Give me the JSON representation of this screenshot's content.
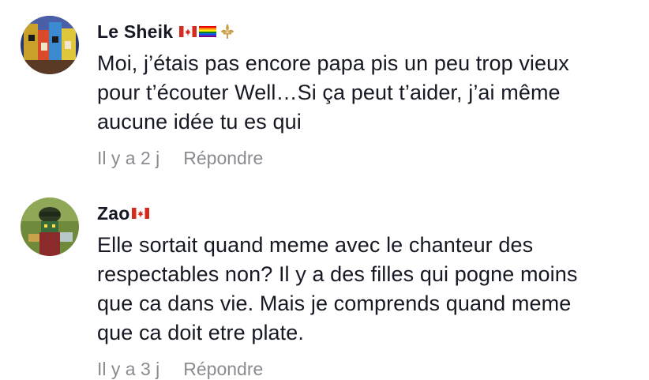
{
  "comments": [
    {
      "username": "Le Sheik",
      "badges": [
        "canada-flag-icon",
        "rainbow-flag-icon",
        "fleur-de-lis-icon"
      ],
      "text": "Moi, j’étais pas encore papa pis un peu trop vieux\npour t’écouter Well…Si ça peut t’aider, j’ai même\naucune idée tu es qui",
      "time": "Il y a 2 j",
      "reply_label": "Répondre"
    },
    {
      "username": "Zao",
      "badges": [
        "canada-flag-icon"
      ],
      "text": "Elle sortait quand meme avec le chanteur des\nrespectables non? Il y a des filles qui pogne moins\nque ca dans vie. Mais je comprends quand meme\nque ca doit etre plate.",
      "time": "Il y a 3 j",
      "reply_label": "Répondre"
    }
  ],
  "colors": {
    "text": "#161823",
    "muted": "#8a8b91",
    "background": "#ffffff"
  }
}
